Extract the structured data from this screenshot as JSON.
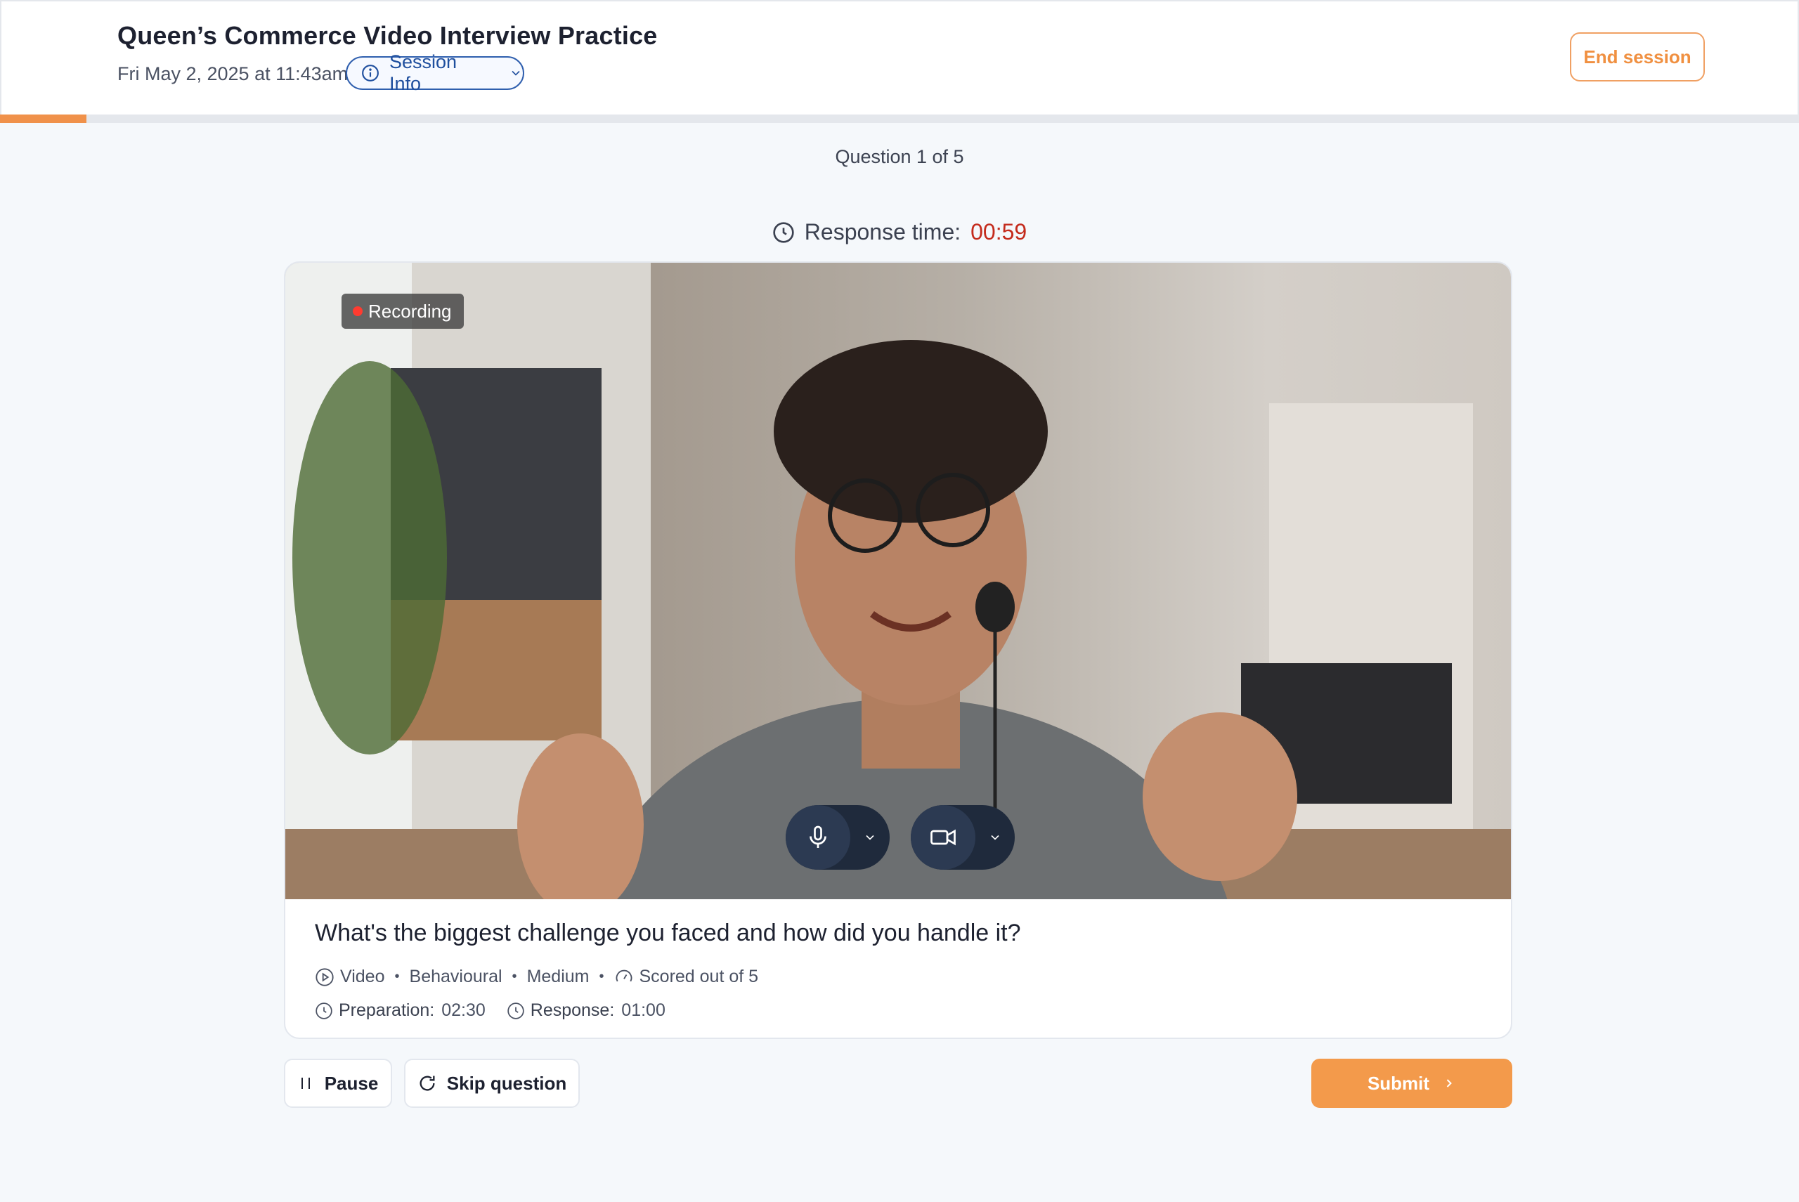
{
  "header": {
    "title": "Queen’s Commerce Video Interview Practice",
    "datetime": "Fri May 2, 2025 at 11:43am",
    "session_info_label": "Session Info",
    "end_session_label": "End session"
  },
  "progress": {
    "current": 1,
    "total": 5,
    "fraction": 0.2
  },
  "question_counter": "Question 1 of 5",
  "timer": {
    "label": "Response time:",
    "value": "00:59"
  },
  "video": {
    "recording_label": "Recording",
    "mic_icon": "microphone-icon",
    "camera_icon": "video-camera-icon"
  },
  "question": {
    "text": "What's the biggest challenge you faced and how did you handle it?",
    "type": "Video",
    "category": "Behavioural",
    "difficulty": "Medium",
    "scoring": "Scored out of 5",
    "preparation_label": "Preparation:",
    "preparation_value": "02:30",
    "response_label": "Response:",
    "response_value": "01:00"
  },
  "actions": {
    "pause_label": "Pause",
    "skip_label": "Skip question",
    "submit_label": "Submit"
  },
  "colors": {
    "accent": "#f39a4b",
    "timer_red": "#c42b1c",
    "session_blue": "#2f5fae"
  }
}
